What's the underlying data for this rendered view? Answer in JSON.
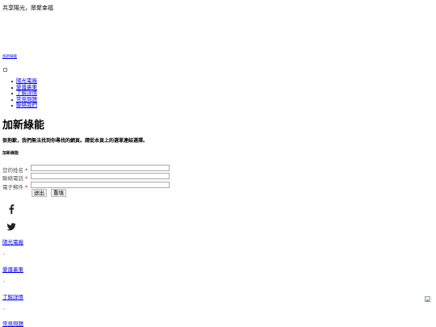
{
  "header": {
    "tagline": "共享陽光，眾聚幸福",
    "logo_link": "加新綠能",
    "menu_toggle": "menu-toggle-checkbox"
  },
  "nav": {
    "items": [
      {
        "label": "陽光電廠"
      },
      {
        "label": "愛護裏東"
      },
      {
        "label": "了解詳情"
      },
      {
        "label": "常見問題"
      },
      {
        "label": "聯絡我們"
      }
    ]
  },
  "main": {
    "title": "加新綠能",
    "not_found": "很抱歉，我們無法找到你尋找的網頁。請從本頁上的選單連結選擇。"
  },
  "form": {
    "heading": "加新綠能",
    "fields": [
      {
        "label": "您的姓名",
        "required": "*",
        "value": ""
      },
      {
        "label": "聯絡電話",
        "required": "*",
        "value": ""
      },
      {
        "label": "電子郵件",
        "required": "*",
        "value": ""
      }
    ],
    "submit_label": "送出",
    "reset_label": "重填"
  },
  "social": {
    "facebook_icon": "facebook-icon",
    "twitter_icon": "twitter-icon"
  },
  "footer": {
    "links": [
      {
        "label": "陽光電廠"
      },
      {
        "label": "愛護裏東"
      },
      {
        "label": "了解詳情"
      },
      {
        "label": "常見問題"
      }
    ],
    "separator": "›"
  },
  "colors": {
    "link": "#0000ee",
    "required": "#cc0000"
  }
}
